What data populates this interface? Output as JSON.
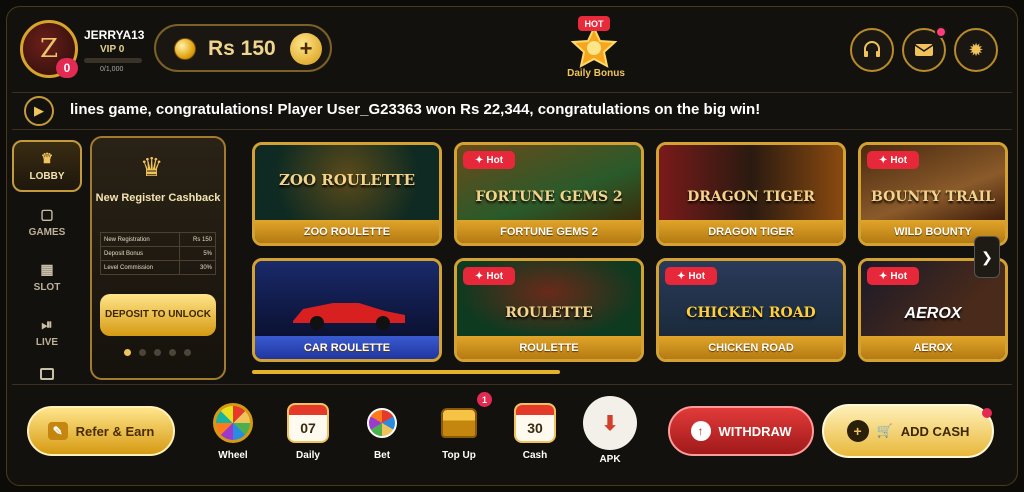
{
  "user": {
    "name": "JERRYA13",
    "vip": "VIP 0",
    "vip_progress": "0/1,000",
    "avatar_badge": "0",
    "avatar_text": "Z"
  },
  "balance": {
    "text": "Rs 150",
    "plus": "+"
  },
  "daily_bonus": {
    "hot": "HOT",
    "label": "Daily Bonus"
  },
  "header_icons": [
    "headset-icon",
    "mail-icon",
    "settings-icon"
  ],
  "ticker": {
    "text": "lines game, congratulations! Player User_G23363 won Rs 22,344, congratulations on the big win!"
  },
  "sidebar": {
    "items": [
      {
        "label": "LOBBY",
        "icon": "crown-icon",
        "active": true
      },
      {
        "label": "GAMES",
        "icon": "gamepad-icon"
      },
      {
        "label": "SLOT",
        "icon": "slot-icon"
      },
      {
        "label": "LIVE",
        "icon": "play-icon"
      }
    ]
  },
  "promo": {
    "title": "New Register Cashback",
    "rows": [
      {
        "label": "New Registration",
        "value": "Rs 150"
      },
      {
        "label": "Deposit Bonus",
        "value": "5%"
      },
      {
        "label": "Level Commission",
        "value": "30%"
      }
    ],
    "button": "DEPOSIT TO UNLOCK"
  },
  "games": [
    {
      "name": "ZOO ROULETTE",
      "thumb_title": "ZOO ROULETTE",
      "hot": false
    },
    {
      "name": "FORTUNE GEMS 2",
      "thumb_title": "FORTUNE GEMS 2",
      "hot": true
    },
    {
      "name": "DRAGON TIGER",
      "thumb_title": "DRAGON TIGER",
      "hot": false
    },
    {
      "name": "WILD BOUNTY",
      "thumb_title": "BOUNTY TRAIL",
      "hot": true
    },
    {
      "name": "CAR ROULETTE",
      "thumb_title": "",
      "hot": false
    },
    {
      "name": "ROULETTE",
      "thumb_title": "ROULETTE",
      "hot": true
    },
    {
      "name": "CHICKEN ROAD",
      "thumb_title": "CHICKEN ROAD",
      "hot": true
    },
    {
      "name": "AEROX",
      "thumb_title": "AEROX",
      "hot": true
    }
  ],
  "hot_label": "Hot",
  "bottom": {
    "refer": "Refer & Earn",
    "items": [
      {
        "label": "Wheel"
      },
      {
        "label": "Daily",
        "day": "07"
      },
      {
        "label": "Bet"
      },
      {
        "label": "Top Up",
        "badge": "1"
      },
      {
        "label": "Cash",
        "day": "30"
      },
      {
        "label": "APK"
      }
    ],
    "withdraw": "WITHDRAW",
    "add_cash": "ADD CASH"
  }
}
